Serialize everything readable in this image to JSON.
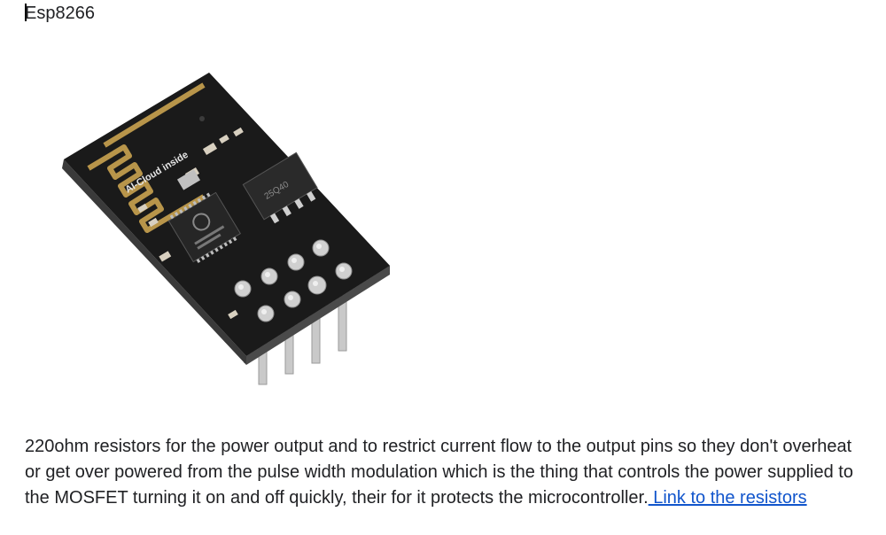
{
  "heading": "Esp8266",
  "image": {
    "antenna_label": "AI-Cloud inside",
    "flash_label": "25Q40"
  },
  "paragraph": {
    "text": "220ohm resistors for the power output and to restrict current flow to the output pins so they don't overheat or get over powered from the pulse width modulation which is the thing that controls the power supplied to the MOSFET turning it on and off quickly, their for it protects the microcontroller.",
    "link_text": " Link to the resistors"
  },
  "colors": {
    "text": "#202124",
    "link": "#1155cc",
    "pcb": "#1a1a1a",
    "antenna_gold": "#b8954a"
  }
}
